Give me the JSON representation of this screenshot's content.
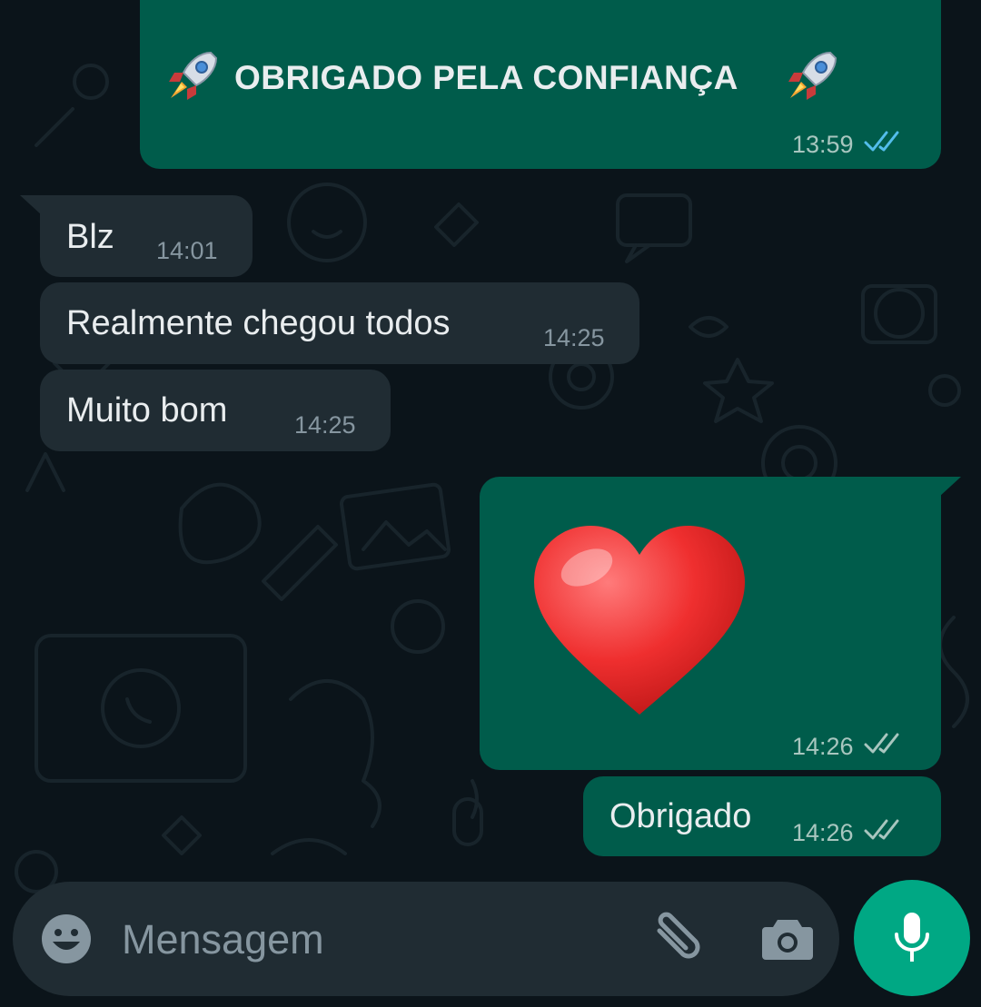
{
  "colors": {
    "background": "#0b141a",
    "outgoing_bubble": "#005c4b",
    "incoming_bubble": "#202c33",
    "read_tick": "#53bdeb",
    "delivered_tick": "#8696a0",
    "accent": "#00a884"
  },
  "messages": [
    {
      "direction": "outgoing",
      "text": "OBRIGADO PELA CONFIANÇA",
      "emoji": "rocket",
      "time": "13:59",
      "status": "read"
    },
    {
      "direction": "incoming",
      "text": "Blz",
      "time": "14:01"
    },
    {
      "direction": "incoming",
      "text": "Realmente chegou todos",
      "time": "14:25"
    },
    {
      "direction": "incoming",
      "text": "Muito bom",
      "time": "14:25"
    },
    {
      "direction": "outgoing",
      "emoji": "red-heart",
      "time": "14:26",
      "status": "delivered"
    },
    {
      "direction": "outgoing",
      "text": "Obrigado",
      "time": "14:26",
      "status": "delivered"
    }
  ],
  "composer": {
    "placeholder": "Mensagem",
    "icons": [
      "emoji-icon",
      "paperclip-icon",
      "camera-icon"
    ],
    "send_button_icon": "microphone-icon"
  }
}
